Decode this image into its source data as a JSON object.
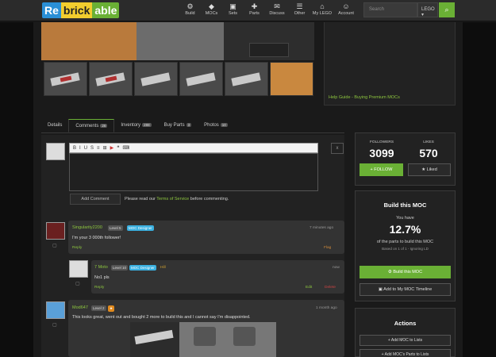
{
  "header": {
    "logo": {
      "re": "Re",
      "brick": "brick",
      "able": "able"
    },
    "nav": [
      {
        "icon": "⚙",
        "label": "Build"
      },
      {
        "icon": "◆",
        "label": "MOCs"
      },
      {
        "icon": "▣",
        "label": "Sets"
      },
      {
        "icon": "✚",
        "label": "Parts"
      },
      {
        "icon": "✉",
        "label": "Discuss"
      },
      {
        "icon": "☰",
        "label": "Other"
      },
      {
        "icon": "⌂",
        "label": "My LEGO"
      },
      {
        "icon": "☺",
        "label": "Account"
      }
    ],
    "search_placeholder": "Search",
    "currency": "LEGO ▾",
    "search_icon": "⌕"
  },
  "gallery": {
    "help_link": "Help Guide - Buying Premium MOCs"
  },
  "tabs": [
    {
      "label": "Details",
      "count": ""
    },
    {
      "label": "Comments",
      "count": "26"
    },
    {
      "label": "Inventory",
      "count": "288"
    },
    {
      "label": "Buy Parts",
      "count": "3"
    },
    {
      "label": "Photos",
      "count": "10"
    }
  ],
  "editor": {
    "toolbar": [
      "B",
      "I",
      "U",
      "S",
      "≡",
      "⊞",
      "▶",
      "❝",
      "⌨"
    ],
    "close": "x",
    "add_comment": "Add Comment",
    "tos_prefix": "Please read our ",
    "tos_link": "Terms of Service",
    "tos_suffix": " before commenting."
  },
  "comments": [
    {
      "user": "Singularity2200",
      "level": "Level 5",
      "badge": "MOC Designer",
      "time": "7 minutes ago",
      "text": "I'm your 3 000th follower!",
      "reply": "Reply",
      "flag": "Flag"
    },
    {
      "user": "7 Moto",
      "level": "Level 10",
      "badge": "MOC Designer",
      "extra": "Hill",
      "time": "now",
      "text": "No1 pls",
      "reply": "Reply",
      "edit": "Edit",
      "delete": "Delete"
    },
    {
      "user": "Mod647",
      "level": "Level 2",
      "time": "1 month ago",
      "text": "This looks great, went out and bought 2 more to build this and I cannot say I'm disappointed."
    }
  ],
  "sidebar": {
    "followers_label": "FOLLOWERS",
    "followers": "3099",
    "likes_label": "LIKES",
    "likes": "570",
    "follow": "+ FOLLOW",
    "liked": "★ Liked",
    "build_title": "Build this MOC",
    "you_have": "You have",
    "percent": "12.7%",
    "of_parts": "of the parts to build this MOC",
    "based_on": "Based on 1 of 1 - Ignoring LD",
    "build_btn": "⚙ Build this MOC",
    "timeline_btn": "▣ Add to My MOC Timeline",
    "actions_title": "Actions",
    "add_moc": "+ Add MOC to Lists",
    "add_parts": "+ Add MOC's Parts to Lists"
  }
}
